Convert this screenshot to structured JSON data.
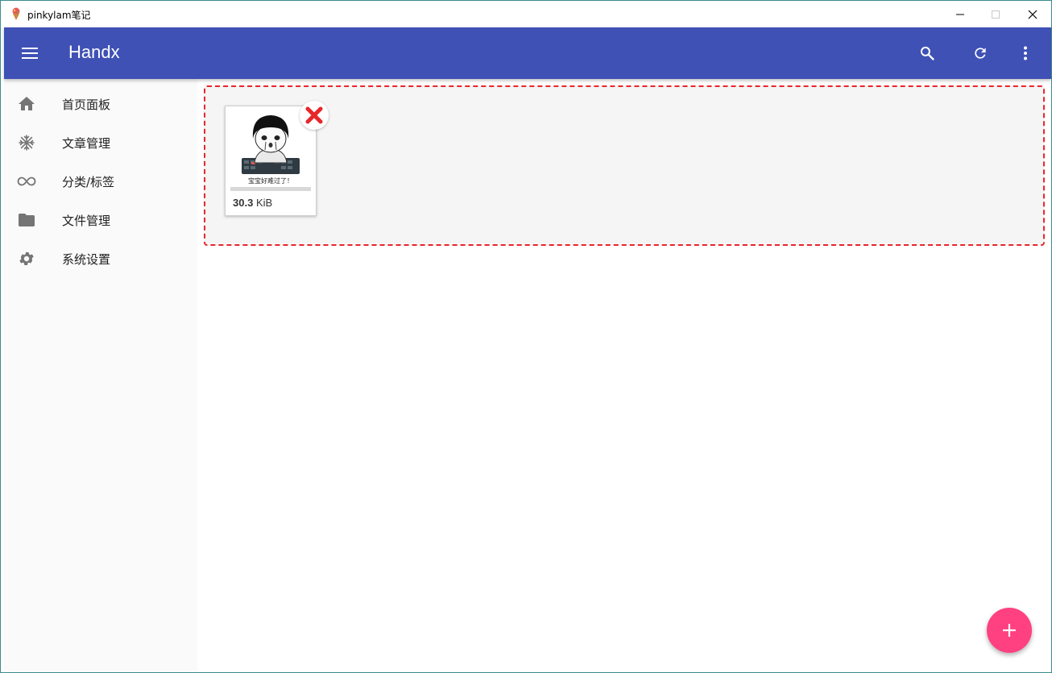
{
  "window": {
    "title": "pinkylam笔记",
    "icon": "ice-cream-app-icon"
  },
  "appbar": {
    "title": "Handx",
    "color": "#3f51b5",
    "actions": [
      "search-icon",
      "refresh-icon",
      "more-vert-icon"
    ]
  },
  "sidebar": {
    "items": [
      {
        "label": "首页面板",
        "icon": "home-icon"
      },
      {
        "label": "文章管理",
        "icon": "snowflake-icon"
      },
      {
        "label": "分类/标签",
        "icon": "infinity-icon"
      },
      {
        "label": "文件管理",
        "icon": "folder-icon"
      },
      {
        "label": "系统设置",
        "icon": "gear-icon"
      }
    ]
  },
  "upload": {
    "border_color": "#e8262a",
    "file": {
      "thumbnail_caption": "宝宝好难过了！",
      "size_value": "30.3",
      "size_unit": "KiB"
    }
  },
  "fab": {
    "label": "+",
    "color": "#ff4081"
  }
}
